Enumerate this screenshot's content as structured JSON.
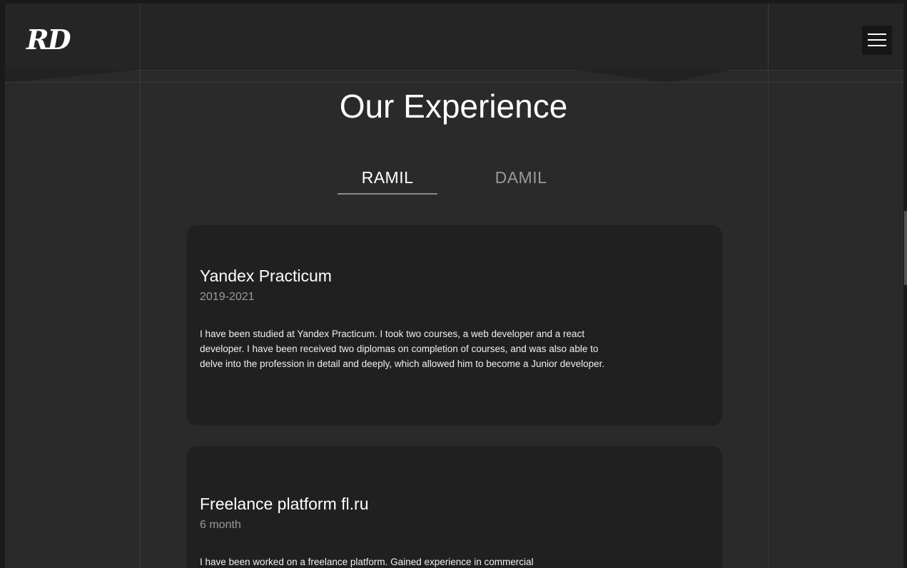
{
  "header": {
    "logo": "RD",
    "menu_icon": "hamburger-icon"
  },
  "section": {
    "title": "Our Experience"
  },
  "tabs": [
    {
      "label": "RAMIL",
      "active": true
    },
    {
      "label": "DAMIL",
      "active": false
    }
  ],
  "experience": [
    {
      "title": "Yandex Practicum",
      "period": "2019-2021",
      "description": "I have been studied at Yandex Practicum. I took two courses, a web developer and a react developer. I have been received two diplomas on completion of courses, and was also able to delve into the profession in detail and deeply, which allowed him to become a Junior developer."
    },
    {
      "title": "Freelance platform fl.ru",
      "period": "6 month",
      "description": "I have been worked on a freelance platform. Gained experience in commercial"
    }
  ],
  "colors": {
    "background": "#2a2a2a",
    "header": "#252525",
    "card": "#202020",
    "muted_text": "#9a9a9a"
  }
}
